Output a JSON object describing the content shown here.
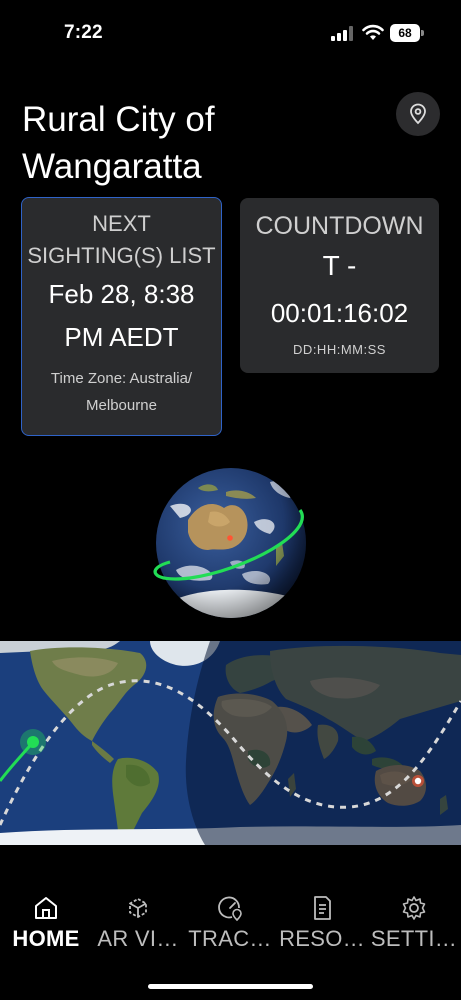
{
  "status_bar": {
    "time": "7:22",
    "battery": "68"
  },
  "header": {
    "title": "Rural City of Wangaratta"
  },
  "next_card": {
    "heading_line1": "NEXT",
    "heading_line2": "SIGHTING(S) LIST",
    "date_line1": "Feb 28, 8:38",
    "date_line2": "PM AEDT",
    "timezone_line1": "Time Zone: Australia/",
    "timezone_line2": "Melbourne"
  },
  "countdown_card": {
    "heading": "COUNTDOWN",
    "prefix": "T -",
    "value": "00:01:16:02",
    "format": "DD:HH:MM:SS"
  },
  "tabs": [
    {
      "label": "HOME",
      "icon": "home-icon",
      "active": true
    },
    {
      "label": "AR VI…",
      "icon": "ar-cube-icon",
      "active": false
    },
    {
      "label": "TRAC…",
      "icon": "track-gauge-icon",
      "active": false
    },
    {
      "label": "RESO…",
      "icon": "document-icon",
      "active": false
    },
    {
      "label": "SETTI…",
      "icon": "gear-icon",
      "active": false
    }
  ],
  "colors": {
    "background": "#000000",
    "card": "#2a2b2d",
    "card_border_active": "#2f63c8",
    "orbit_green": "#22dd55",
    "ground_track": "#d8d8d8",
    "location_marker": "#ff5533"
  }
}
